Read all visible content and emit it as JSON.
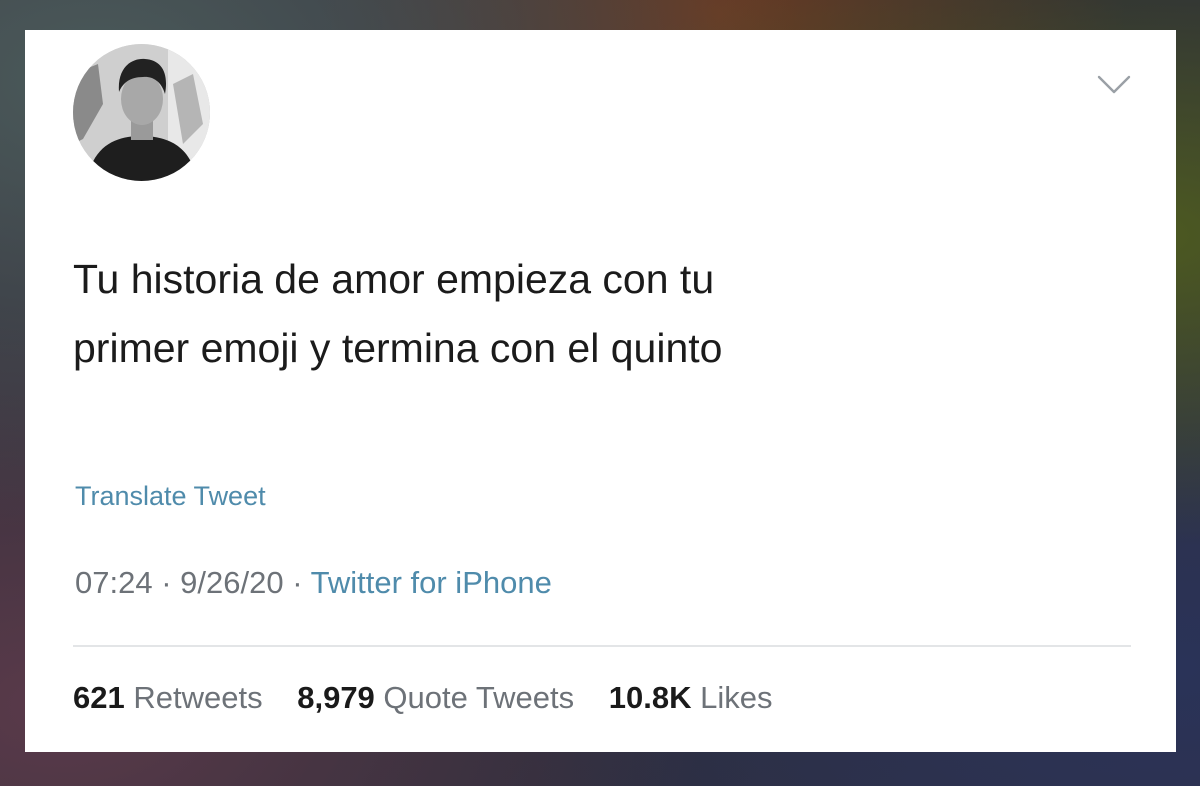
{
  "tweet": {
    "text_line1": "Tu historia de amor empieza con tu",
    "text_line2": "primer emoji y termina con el quinto",
    "translate_label": "Translate Tweet",
    "time": "07:24",
    "date": "9/26/20",
    "separator": "·",
    "source": "Twitter for iPhone",
    "stats": [
      {
        "count": "621",
        "label": "Retweets"
      },
      {
        "count": "8,979",
        "label": "Quote Tweets"
      },
      {
        "count": "10.8K",
        "label": "Likes"
      }
    ],
    "icons": {
      "menu": "chevron-down-icon"
    },
    "colors": {
      "link": "#4f8bab",
      "text": "#1b1b1b",
      "muted": "#6d7278",
      "card": "#ffffff"
    }
  }
}
